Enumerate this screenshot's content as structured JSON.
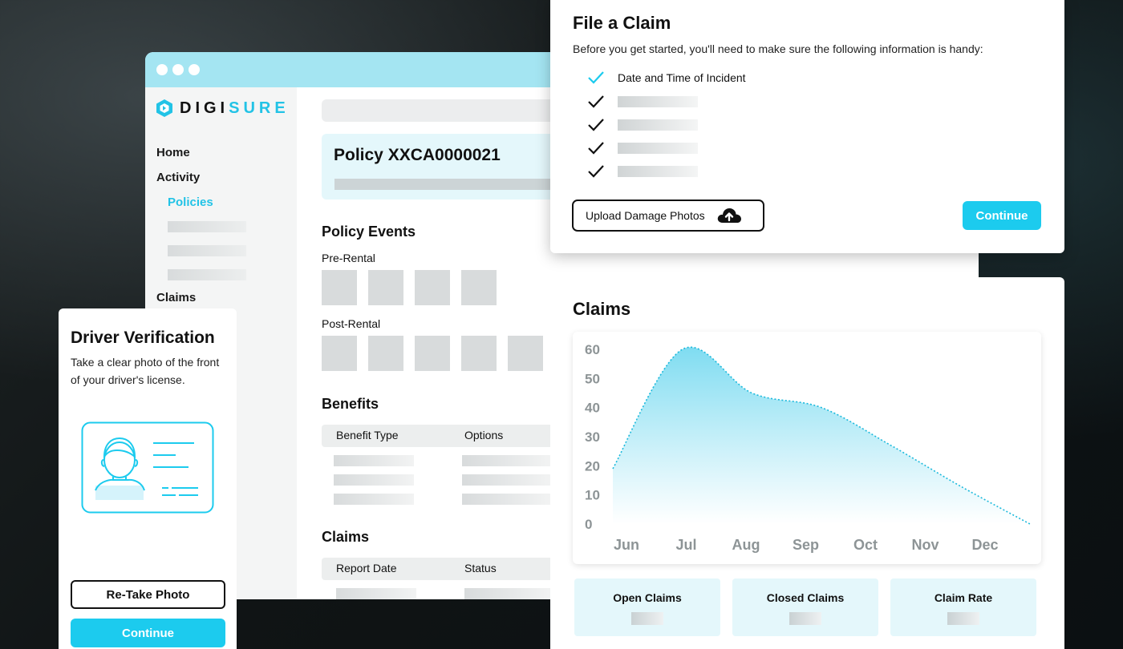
{
  "logo": {
    "text_main": "DIGI",
    "text_accent": "SURE"
  },
  "colors": {
    "accent": "#1ccbee",
    "titlebar": "#a4e5f2",
    "panel_light": "#e4f7fb"
  },
  "sidebar": {
    "items": [
      {
        "label": "Home"
      },
      {
        "label": "Activity"
      },
      {
        "label": "Policies"
      },
      {
        "label": "Claims"
      }
    ]
  },
  "policy": {
    "title": "Policy XXCA0000021",
    "events_title": "Policy Events",
    "pre_rental_label": "Pre-Rental",
    "post_rental_label": "Post-Rental",
    "benefits_title": "Benefits",
    "benefits_columns": [
      "Benefit Type",
      "Options"
    ],
    "claims_title": "Claims",
    "claims_columns": [
      "Report Date",
      "Status"
    ]
  },
  "file_claim": {
    "title": "File a Claim",
    "description": "Before you get started, you'll need to make sure the following information is handy:",
    "first_item": "Date and Time of Incident",
    "upload_label": "Upload Damage Photos",
    "upload_icon": "cloud-upload-icon",
    "continue_label": "Continue"
  },
  "claims_chart": {
    "title": "Claims",
    "stats": [
      {
        "label": "Open Claims"
      },
      {
        "label": "Closed Claims"
      },
      {
        "label": "Claim Rate"
      }
    ]
  },
  "chart_data": {
    "type": "area",
    "title": "Claims",
    "xlabel": "",
    "ylabel": "",
    "x": [
      "Jun",
      "Jul",
      "Aug",
      "Sep",
      "Oct",
      "Nov",
      "Dec"
    ],
    "values": [
      19,
      60,
      45,
      40,
      27,
      13,
      0
    ],
    "ylim": [
      0,
      60
    ],
    "yticks": [
      0,
      10,
      20,
      30,
      40,
      50,
      60
    ],
    "grid": false,
    "legend": "none"
  },
  "driver": {
    "title": "Driver Verification",
    "description": "Take a clear photo of the front of your driver's license.",
    "license_icon": "driver-license-icon",
    "retake_label": "Re-Take Photo",
    "continue_label": "Continue"
  }
}
